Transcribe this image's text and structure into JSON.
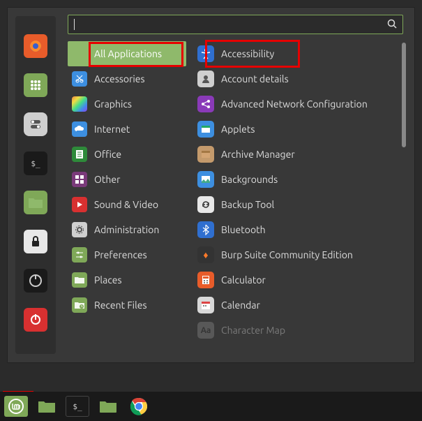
{
  "search": {
    "value": "",
    "placeholder": ""
  },
  "categories": [
    {
      "label": "All Applications",
      "selected": true,
      "icon": "apps",
      "bg": "#8fb96b"
    },
    {
      "label": "Accessories",
      "icon": "scissors",
      "bg": "#3d8fe0"
    },
    {
      "label": "Graphics",
      "icon": "rainbow",
      "bg": "linear"
    },
    {
      "label": "Internet",
      "icon": "cloud",
      "bg": "#3d8fe0"
    },
    {
      "label": "Office",
      "icon": "doc",
      "bg": "#2e8a3a"
    },
    {
      "label": "Other",
      "icon": "grid",
      "bg": "#7a3a7a"
    },
    {
      "label": "Sound & Video",
      "icon": "play",
      "bg": "#d83030"
    },
    {
      "label": "Administration",
      "icon": "gears",
      "bg": "#cfcfcf"
    },
    {
      "label": "Preferences",
      "icon": "sliders",
      "bg": "#7fa858"
    },
    {
      "label": "Places",
      "icon": "folder",
      "bg": "#7fa858"
    },
    {
      "label": "Recent Files",
      "icon": "folder-clock",
      "bg": "#7fa858"
    }
  ],
  "apps": [
    {
      "label": "Accessibility",
      "icon": "accessibility",
      "bg": "#2f6fd0"
    },
    {
      "label": "Account details",
      "icon": "user",
      "bg": "#cfcfcf"
    },
    {
      "label": "Advanced Network Configuration",
      "icon": "net",
      "bg": "#8a3ab8"
    },
    {
      "label": "Applets",
      "icon": "window",
      "bg": "#3d8fe0"
    },
    {
      "label": "Archive Manager",
      "icon": "box",
      "bg": "#c49a6c"
    },
    {
      "label": "Backgrounds",
      "icon": "picture",
      "bg": "#3d8fe0"
    },
    {
      "label": "Backup Tool",
      "icon": "refresh",
      "bg": "#e8e8e8"
    },
    {
      "label": "Bluetooth",
      "icon": "bluetooth",
      "bg": "#2f6fd0"
    },
    {
      "label": "Burp Suite Community Edition",
      "icon": "burp",
      "bg": "#333"
    },
    {
      "label": "Calculator",
      "icon": "calc",
      "bg": "#e85c2a"
    },
    {
      "label": "Calendar",
      "icon": "calendar",
      "bg": "#d8d8d8"
    },
    {
      "label": "Character Map",
      "icon": "charmap",
      "bg": "#888",
      "faded": true
    }
  ],
  "favorites": [
    {
      "name": "firefox",
      "bg": "#e85c2a"
    },
    {
      "name": "apps",
      "bg": "#7fa858"
    },
    {
      "name": "switch",
      "bg": "#cfcfcf"
    },
    {
      "name": "terminal",
      "bg": "#1a1a1a"
    },
    {
      "name": "files",
      "bg": "#7fa858"
    },
    {
      "name": "lock",
      "bg": "#e8e8e8"
    },
    {
      "name": "logout",
      "bg": "#1a1a1a"
    },
    {
      "name": "power",
      "bg": "#d83030"
    }
  ],
  "taskbar": [
    {
      "name": "mint-menu",
      "bg": "#7fa858"
    },
    {
      "name": "files",
      "bg": "#7fa858"
    },
    {
      "name": "terminal",
      "bg": "#1a1a1a"
    },
    {
      "name": "files2",
      "bg": "#7fa858"
    },
    {
      "name": "chrome",
      "bg": "#fff"
    }
  ]
}
